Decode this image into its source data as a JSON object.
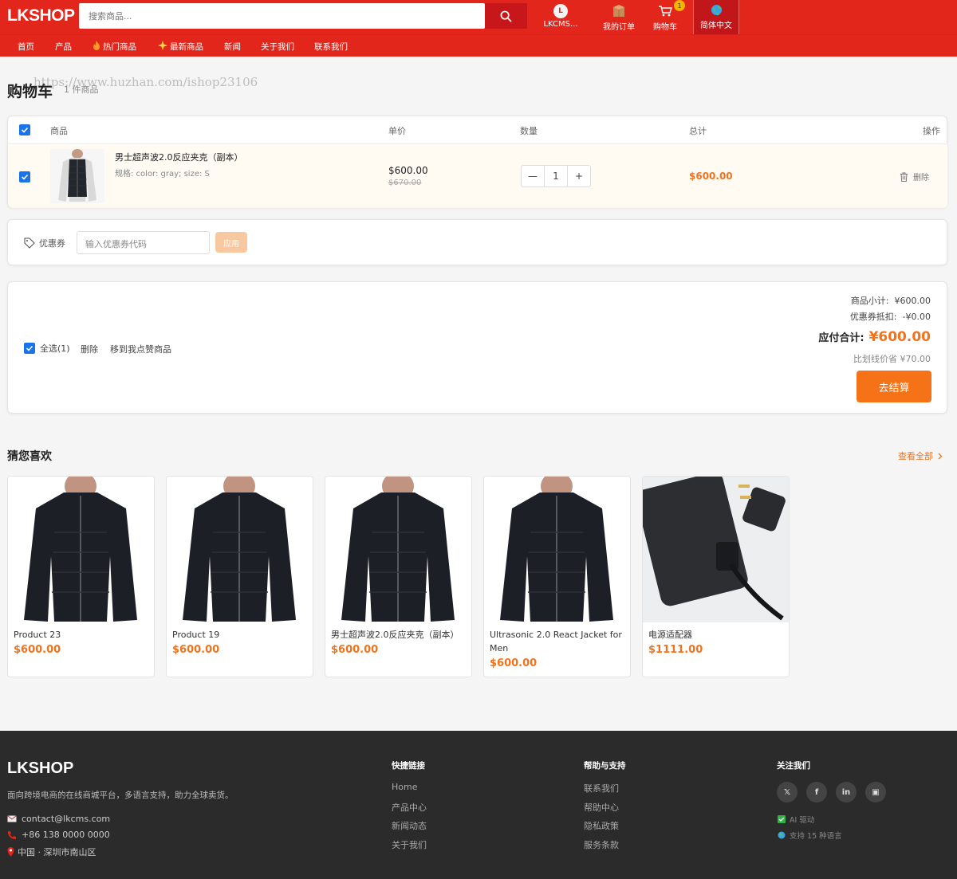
{
  "header": {
    "logo": "LKSHOP",
    "search_placeholder": "搜索商品...",
    "user_avatar_letter": "L",
    "user_name": "LKCMS...",
    "orders_label": "我的订单",
    "cart_label": "购物车",
    "cart_badge": "1",
    "language_label": "简体中文"
  },
  "nav": {
    "items": [
      "首页",
      "产品",
      "热门商品",
      "最新商品",
      "新闻",
      "关于我们",
      "联系我们"
    ]
  },
  "cart": {
    "title": "购物车",
    "item_count": "1 件商品",
    "watermark": "https://www.huzhan.com/ishop23106",
    "columns": [
      "商品",
      "单价",
      "数量",
      "总计",
      "操作"
    ],
    "item": {
      "name": "男士超声波2.0反应夹克（副本）",
      "spec": "规格: color: gray;  size: S",
      "price": "$600.00",
      "original_price": "$670.00",
      "quantity": "1",
      "total": "$600.00",
      "delete_label": "删除"
    },
    "coupon": {
      "label": "优惠券",
      "placeholder": "输入优惠券代码",
      "apply_label": "应用"
    },
    "summary": {
      "select_all": "全选(1)",
      "delete": "删除",
      "move_to_fav": "移到我点赞商品",
      "subtotal_label": "商品小计:",
      "subtotal": "¥600.00",
      "discount_label": "优惠券抵扣:",
      "discount": "-¥0.00",
      "total_label": "应付合计:",
      "total": "¥600.00",
      "saved": "比划线价省 ¥70.00",
      "checkout_label": "去结算"
    }
  },
  "recommend": {
    "title": "猜您喜欢",
    "more_label": "查看全部",
    "products": [
      {
        "name": "Product 23",
        "price": "$600.00"
      },
      {
        "name": "Product 19",
        "price": "$600.00"
      },
      {
        "name": "男士超声波2.0反应夹克（副本）",
        "price": "$600.00"
      },
      {
        "name": "Ultrasonic 2.0 React Jacket for Men",
        "price": "$600.00"
      },
      {
        "name": "电源适配器",
        "price": "$1111.00"
      }
    ]
  },
  "footer": {
    "logo": "LKSHOP",
    "description": "面向跨境电商的在线商城平台，多语言支持，助力全球卖货。",
    "email": "contact@lkcms.com",
    "phone": "+86 138 0000 0000",
    "address": "中国 · 深圳市南山区",
    "quick_links_title": "快捷链接",
    "quick_links": [
      "Home",
      "产品中心",
      "新闻动态",
      "关于我们"
    ],
    "help_title": "帮助与支持",
    "help_links": [
      "联系我们",
      "帮助中心",
      "隐私政策",
      "服务条款"
    ],
    "follow_title": "关注我们",
    "social": [
      "𝕏",
      "f",
      "in",
      "▣"
    ],
    "tag_ai": "AI 驱动",
    "tag_lang": "支持 15 种语言"
  },
  "colors": {
    "brand_red": "#e3261b",
    "accent_orange": "#f57216",
    "checkbox_blue": "#1a73e8",
    "footer_bg": "#2b2b2b"
  }
}
